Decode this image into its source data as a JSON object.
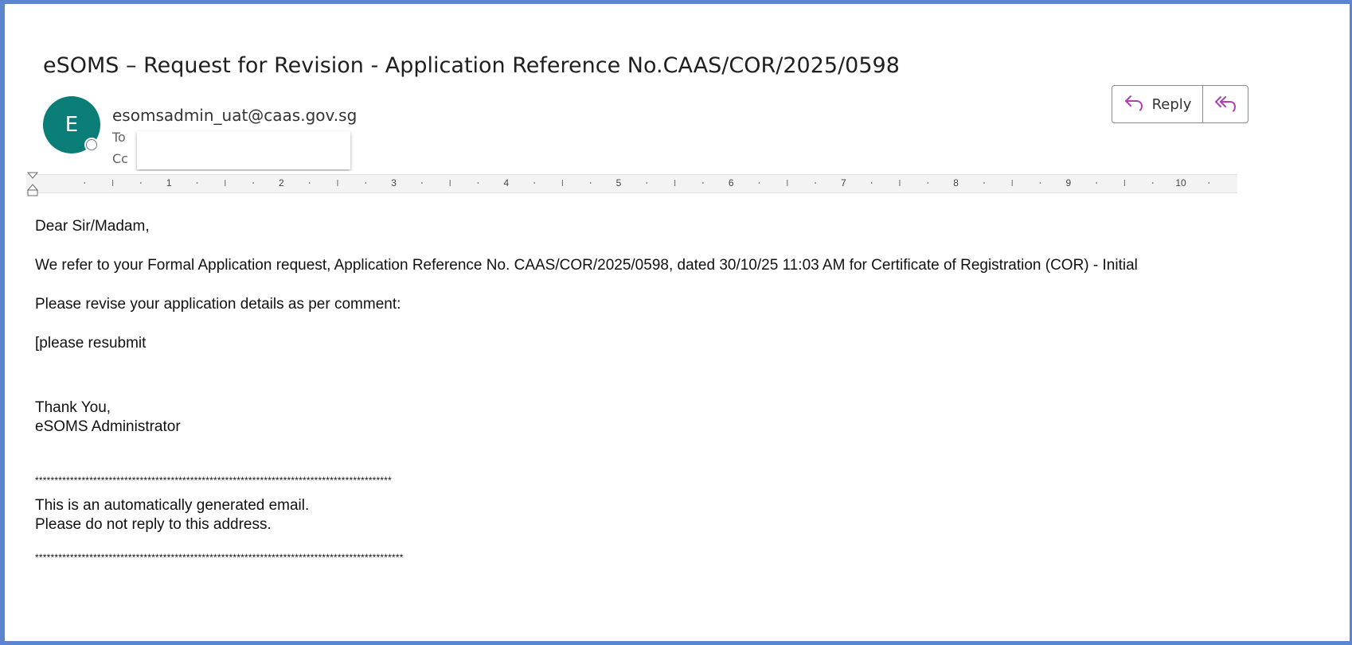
{
  "email": {
    "subject": "eSOMS – Request for Revision - Application Reference No.CAAS/COR/2025/0598",
    "sender": {
      "initial": "E",
      "address": "esomsadmin_uat@caas.gov.sg"
    },
    "to_label": "To",
    "cc_label": "Cc"
  },
  "actions": {
    "reply_label": "Reply",
    "reply_icon": "reply-arrow-icon",
    "reply_all_icon": "reply-all-arrow-icon",
    "icon_color": "#b03fb0"
  },
  "ruler": {
    "numbers": [
      "1",
      "2",
      "3",
      "4",
      "5",
      "6",
      "7",
      "8",
      "9",
      "10"
    ]
  },
  "body": {
    "greeting": "Dear Sir/Madam,",
    "paragraph1": "We refer to your Formal Application request, Application Reference No. CAAS/COR/2025/0598, dated 30/10/25 11:03 AM for Certificate of Registration (COR) - Initial",
    "paragraph2": "Please revise your application details as per comment:",
    "comment": "[please resubmit",
    "closing": "Thank You,",
    "signature": "eSOMS Administrator",
    "stars_line1": "********************************************************************************************",
    "notice_line1": "This is an automatically generated email.",
    "notice_line2": "Please do not reply to this address.",
    "stars_line2": "***********************************************************************************************"
  },
  "colors": {
    "frame": "#5b86cf",
    "avatar": "#0a7d76"
  }
}
